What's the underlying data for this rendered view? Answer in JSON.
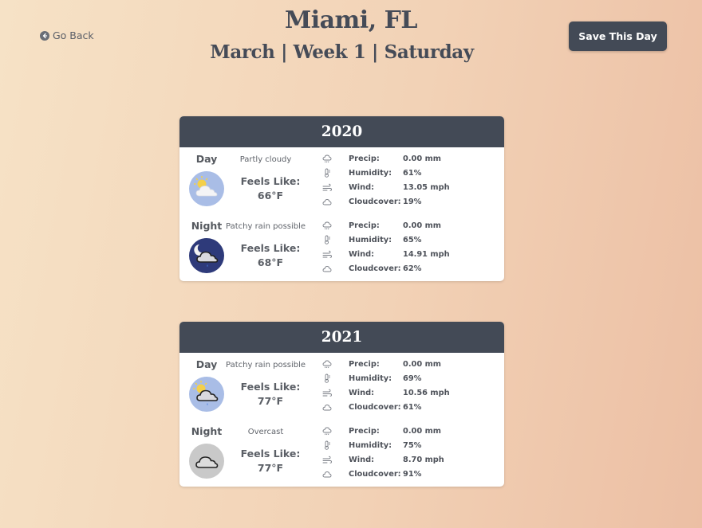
{
  "header": {
    "back_label": "Go Back",
    "title": "Miami, FL",
    "subtitle": "March | Week 1 | Saturday",
    "save_label": "Save This Day"
  },
  "labels": {
    "feels_like": "Feels Like:",
    "precip": "Precip:",
    "humidity": "Humidity:",
    "wind": "Wind:",
    "cloudcover": "Cloudcover:"
  },
  "years": [
    {
      "year": "2020",
      "day": {
        "label": "Day",
        "condition": "Partly cloudy",
        "icon": "partly-cloudy-day-icon",
        "feels": "66°F",
        "precip": "0.00 mm",
        "humidity": "61%",
        "wind": "13.05 mph",
        "cloud": "19%"
      },
      "night": {
        "label": "Night",
        "condition": "Patchy rain possible",
        "icon": "rain-night-icon",
        "feels": "68°F",
        "precip": "0.00 mm",
        "humidity": "65%",
        "wind": "14.91 mph",
        "cloud": "62%"
      }
    },
    {
      "year": "2021",
      "day": {
        "label": "Day",
        "condition": "Patchy rain possible",
        "icon": "rain-day-icon",
        "feels": "77°F",
        "precip": "0.00 mm",
        "humidity": "69%",
        "wind": "10.56 mph",
        "cloud": "61%"
      },
      "night": {
        "label": "Night",
        "condition": "Overcast",
        "icon": "overcast-icon",
        "feels": "77°F",
        "precip": "0.00 mm",
        "humidity": "75%",
        "wind": "8.70 mph",
        "cloud": "91%"
      }
    }
  ],
  "colors": {
    "header_dark": "#434a56",
    "text": "#454b57",
    "day_icon_bg": "#a9bde6",
    "night_icon_bg": "#2e3a7a",
    "overcast_icon_bg": "#c9c9c9"
  }
}
